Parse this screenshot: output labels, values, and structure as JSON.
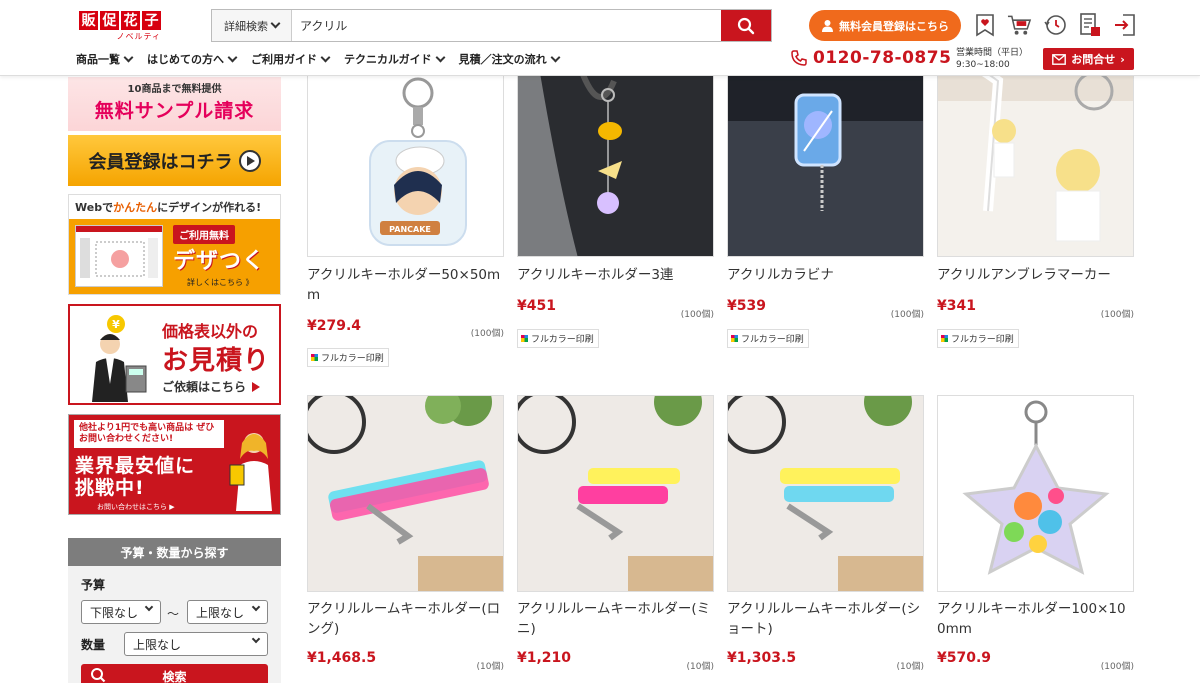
{
  "header": {
    "logo_chars": [
      "販",
      "促",
      "花",
      "子"
    ],
    "logo_sub": "ノベルティ",
    "search_type": "詳細検索",
    "search_value": "アクリル",
    "register_label": "無料会員登録はこちら",
    "nav": [
      "商品一覧",
      "はじめての方へ",
      "ご利用ガイド",
      "テクニカルガイド",
      "見積／注文の流れ"
    ],
    "phone": "0120-78-0875",
    "hours_label": "営業時間（平日）",
    "hours_time": "9:30~18:00",
    "contact_label": "お問合せ"
  },
  "sidebar": {
    "sample_sub": "10商品まで無料提供",
    "sample_title": "無料サンプル請求",
    "member_title": "会員登録はコチラ",
    "design_pre": "Webで",
    "design_hl": "かんたん",
    "design_post": "にデザインが作れる!",
    "design_free": "ご利用無料",
    "design_name": "デザつく",
    "design_more": "詳しくはこちら 》",
    "quote_1": "価格表以外の",
    "quote_2": "お見積り",
    "quote_3": "ご依頼はこちら",
    "cheap_1": "他社より1円でも高い商品は ぜひお問い合わせください!",
    "cheap_2a": "業界最安値に",
    "cheap_2b": "挑戦中!",
    "cheap_3": "お問い合わせはこちら ▶",
    "filter_title": "予算・数量から探す",
    "budget_label": "予算",
    "budget_min": "下限なし",
    "budget_max": "上限なし",
    "tilde": "～",
    "qty_label": "数量",
    "qty_value": "上限なし",
    "search_label": "検索"
  },
  "products": [
    {
      "name": "アクリルキーホルダー50×50mm",
      "price": "¥279.4",
      "unit": "(100個)",
      "tag": "フルカラー印刷"
    },
    {
      "name": "アクリルキーホルダー3連",
      "price": "¥451",
      "unit": "(100個)",
      "tag": "フルカラー印刷"
    },
    {
      "name": "アクリルカラビナ",
      "price": "¥539",
      "unit": "(100個)",
      "tag": "フルカラー印刷"
    },
    {
      "name": "アクリルアンブレラマーカー",
      "price": "¥341",
      "unit": "(100個)",
      "tag": "フルカラー印刷"
    },
    {
      "name": "アクリルルームキーホルダー(ロング)",
      "price": "¥1,468.5",
      "unit": "(10個)",
      "tag": ""
    },
    {
      "name": "アクリルルームキーホルダー(ミニ)",
      "price": "¥1,210",
      "unit": "(10個)",
      "tag": ""
    },
    {
      "name": "アクリルルームキーホルダー(ショート)",
      "price": "¥1,303.5",
      "unit": "(10個)",
      "tag": ""
    },
    {
      "name": "アクリルキーホルダー100×100mm",
      "price": "¥570.9",
      "unit": "(100個)",
      "tag": ""
    }
  ],
  "colors": {
    "brand_red": "#c9151e",
    "orange": "#f06a1c"
  }
}
